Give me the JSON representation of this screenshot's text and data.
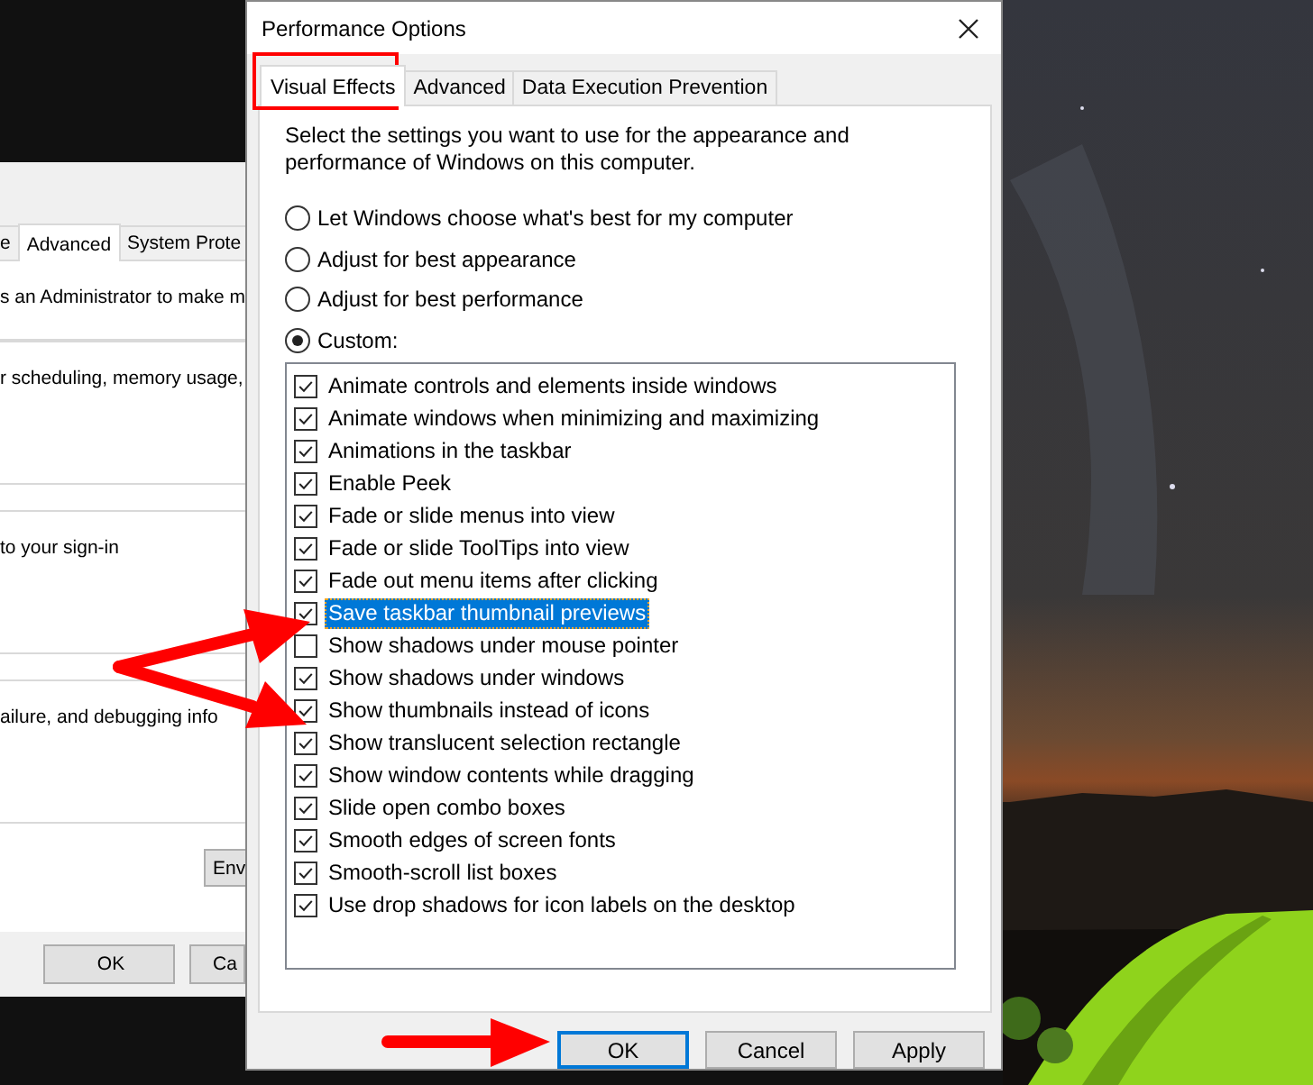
{
  "background_window": {
    "tabs": [
      {
        "label": "e",
        "selected": false
      },
      {
        "label": "Advanced",
        "selected": true
      },
      {
        "label": "System Prote",
        "selected": false
      }
    ],
    "lines": [
      "s an Administrator to make m",
      "r scheduling, memory usage,",
      "to your sign-in",
      "ailure, and debugging info"
    ],
    "env_button": "Env",
    "buttons": [
      "OK",
      "Ca"
    ]
  },
  "dialog": {
    "title": "Performance Options",
    "tabs": [
      {
        "label": "Visual Effects",
        "selected": true
      },
      {
        "label": "Advanced",
        "selected": false
      },
      {
        "label": "Data Execution Prevention",
        "selected": false
      }
    ],
    "description": "Select the settings you want to use for the appearance and\nperformance of Windows on this computer.",
    "options": [
      {
        "label": "Let Windows choose what's best for my computer",
        "selected": false
      },
      {
        "label": "Adjust for best appearance",
        "selected": false
      },
      {
        "label": "Adjust for best performance",
        "selected": false
      },
      {
        "label": "Custom:",
        "selected": true
      }
    ],
    "effects": [
      {
        "label": "Animate controls and elements inside windows",
        "checked": true,
        "selected": false
      },
      {
        "label": "Animate windows when minimizing and maximizing",
        "checked": true,
        "selected": false
      },
      {
        "label": "Animations in the taskbar",
        "checked": true,
        "selected": false
      },
      {
        "label": "Enable Peek",
        "checked": true,
        "selected": false
      },
      {
        "label": "Fade or slide menus into view",
        "checked": true,
        "selected": false
      },
      {
        "label": "Fade or slide ToolTips into view",
        "checked": true,
        "selected": false
      },
      {
        "label": "Fade out menu items after clicking",
        "checked": true,
        "selected": false
      },
      {
        "label": "Save taskbar thumbnail previews",
        "checked": true,
        "selected": true
      },
      {
        "label": "Show shadows under mouse pointer",
        "checked": false,
        "selected": false
      },
      {
        "label": "Show shadows under windows",
        "checked": true,
        "selected": false
      },
      {
        "label": "Show thumbnails instead of icons",
        "checked": true,
        "selected": false
      },
      {
        "label": "Show translucent selection rectangle",
        "checked": true,
        "selected": false
      },
      {
        "label": "Show window contents while dragging",
        "checked": true,
        "selected": false
      },
      {
        "label": "Slide open combo boxes",
        "checked": true,
        "selected": false
      },
      {
        "label": "Smooth edges of screen fonts",
        "checked": true,
        "selected": false
      },
      {
        "label": "Smooth-scroll list boxes",
        "checked": true,
        "selected": false
      },
      {
        "label": "Use drop shadows for icon labels on the desktop",
        "checked": true,
        "selected": false
      }
    ],
    "buttons": [
      {
        "label": "OK",
        "default": true
      },
      {
        "label": "Cancel",
        "default": false
      },
      {
        "label": "Apply",
        "default": false
      }
    ]
  }
}
